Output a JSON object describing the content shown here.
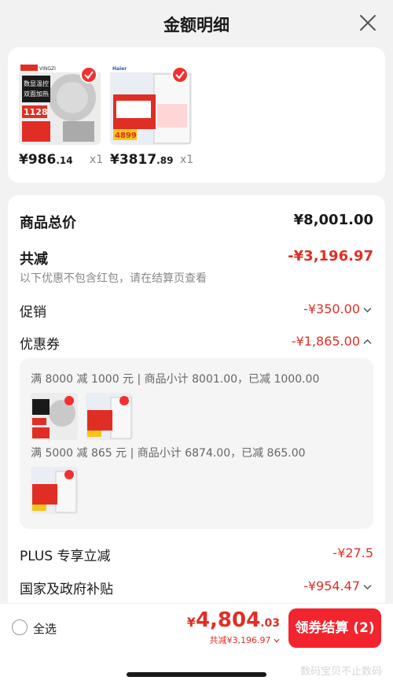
{
  "header": {
    "title": "金额明细",
    "close_icon": "close-icon"
  },
  "products": [
    {
      "brand": "VINGZI",
      "tag1": "数显温控",
      "tag2": "双面加热",
      "badge_price": "1128",
      "price_int": "¥986",
      "price_dec": ".14",
      "qty": "x1",
      "selected": true
    },
    {
      "brand": "Haier",
      "badge_price": "4899",
      "price_int": "¥3817",
      "price_dec": ".89",
      "qty": "x1",
      "selected": true
    }
  ],
  "summary": {
    "total_label": "商品总价",
    "total_value": "¥8,001.00",
    "reduce_label": "共减",
    "reduce_value": "-¥3,196.97",
    "reduce_note": "以下优惠不包含红包，请在结算页查看",
    "promo_label": "促销",
    "promo_value": "-¥350.00",
    "coupon_label": "优惠券",
    "coupon_value": "-¥1,865.00",
    "coupons": [
      {
        "text": "满 8000 减 1000 元 | 商品小计 8001.00，已减 1000.00"
      },
      {
        "text": "满 5000 减 865 元 | 商品小计 6874.00，已减 865.00"
      }
    ],
    "plus_label": "PLUS 专享立减",
    "plus_value": "-¥27.5",
    "gov_label": "国家及政府补贴",
    "gov_value": "-¥954.47"
  },
  "bottom": {
    "select_all": "全选",
    "yen": "¥",
    "total_int": "4,804",
    "total_dec": ".03",
    "saved_text": "共减¥3,196.97",
    "checkout_label": "领券结算 (2)"
  },
  "watermark": "数码宝贝不止数码",
  "colors": {
    "accent": "#e02e24",
    "button": "#f2242e"
  }
}
